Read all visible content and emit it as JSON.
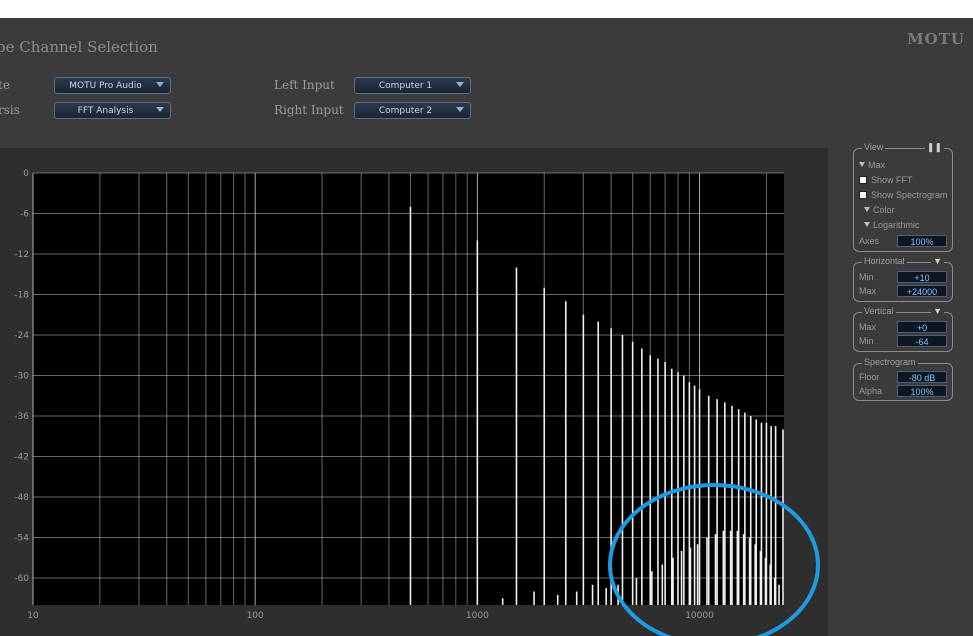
{
  "window": {
    "title": "pe Channel Selection",
    "brand": "MOTU"
  },
  "controls": {
    "device_label": "te",
    "device_value": "MOTU Pro Audio",
    "analysis_label": "rsis",
    "analysis_value": "FFT Analysis",
    "left_input_label": "Left Input",
    "left_input_value": "Computer 1",
    "right_input_label": "Right Input",
    "right_input_value": "Computer 2"
  },
  "view_panel": {
    "title": "View",
    "pause_icon": "pause-icon",
    "items": [
      {
        "kind": "triangle",
        "label": "Max"
      },
      {
        "kind": "checkbox",
        "label": "Show FFT"
      },
      {
        "kind": "checkbox",
        "label": "Show Spectrogram"
      },
      {
        "kind": "triangle",
        "label": "Color"
      },
      {
        "kind": "triangle",
        "label": "Logarithmic"
      }
    ],
    "axes_label": "Axes",
    "axes_value": "100%"
  },
  "horizontal_panel": {
    "title": "Horizontal",
    "min_label": "Min",
    "min_value": "+10",
    "max_label": "Max",
    "max_value": "+24000"
  },
  "vertical_panel": {
    "title": "Vertical",
    "max_label": "Max",
    "max_value": "+0",
    "min_label": "Min",
    "min_value": "-64"
  },
  "spectrogram_panel": {
    "title": "Spectrogram",
    "floor_label": "Floor",
    "floor_value": "-80 dB",
    "alpha_label": "Alpha",
    "alpha_value": "100%"
  },
  "colors": {
    "accent_circle": "#1e9be0",
    "plot_bg": "#000000",
    "bars": "#f0f0f0"
  },
  "chart_data": {
    "type": "bar",
    "xscale": "log",
    "xlim": [
      10,
      24000
    ],
    "ylim": [
      -64,
      0
    ],
    "x_ticks": [
      "10",
      "100",
      "1000",
      "10000"
    ],
    "y_ticks": [
      "0",
      "-6",
      "-12",
      "-18",
      "-24",
      "-30",
      "-36",
      "-42",
      "-48",
      "-54",
      "-60"
    ],
    "grid": true,
    "series": [
      {
        "values": [
          {
            "x": 500,
            "y": -5
          },
          {
            "x": 1000,
            "y": -10
          },
          {
            "x": 1500,
            "y": -14
          },
          {
            "x": 2000,
            "y": -17
          },
          {
            "x": 2500,
            "y": -19
          },
          {
            "x": 3000,
            "y": -21
          },
          {
            "x": 3500,
            "y": -22
          },
          {
            "x": 4000,
            "y": -23
          },
          {
            "x": 4500,
            "y": -24
          },
          {
            "x": 5000,
            "y": -25
          },
          {
            "x": 5500,
            "y": -26
          },
          {
            "x": 6000,
            "y": -27
          },
          {
            "x": 6500,
            "y": -27.5
          },
          {
            "x": 7000,
            "y": -28
          },
          {
            "x": 7500,
            "y": -29
          },
          {
            "x": 8000,
            "y": -29.5
          },
          {
            "x": 8500,
            "y": -30
          },
          {
            "x": 9000,
            "y": -31
          },
          {
            "x": 9500,
            "y": -31.5
          },
          {
            "x": 10000,
            "y": -32
          },
          {
            "x": 11000,
            "y": -33
          },
          {
            "x": 12000,
            "y": -33.5
          },
          {
            "x": 13000,
            "y": -34
          },
          {
            "x": 14000,
            "y": -34.5
          },
          {
            "x": 15000,
            "y": -35
          },
          {
            "x": 16000,
            "y": -35.5
          },
          {
            "x": 17000,
            "y": -36
          },
          {
            "x": 18000,
            "y": -36.5
          },
          {
            "x": 19000,
            "y": -37
          },
          {
            "x": 20000,
            "y": -37
          },
          {
            "x": 21000,
            "y": -37.5
          },
          {
            "x": 22000,
            "y": -37.5
          },
          {
            "x": 24000,
            "y": -38
          }
        ]
      },
      {
        "values": [
          {
            "x": 1300,
            "y": -63
          },
          {
            "x": 1800,
            "y": -62
          },
          {
            "x": 2300,
            "y": -62.5
          },
          {
            "x": 2800,
            "y": -62
          },
          {
            "x": 3300,
            "y": -61
          },
          {
            "x": 3800,
            "y": -61.5
          },
          {
            "x": 4300,
            "y": -61
          },
          {
            "x": 5200,
            "y": -60
          },
          {
            "x": 6100,
            "y": -59
          },
          {
            "x": 6800,
            "y": -58
          },
          {
            "x": 7600,
            "y": -57
          },
          {
            "x": 8300,
            "y": -56
          },
          {
            "x": 9100,
            "y": -55.5
          },
          {
            "x": 9800,
            "y": -55
          },
          {
            "x": 10800,
            "y": -54
          },
          {
            "x": 11800,
            "y": -53.5
          },
          {
            "x": 12800,
            "y": -53
          },
          {
            "x": 13800,
            "y": -53
          },
          {
            "x": 14800,
            "y": -53
          },
          {
            "x": 15800,
            "y": -53.5
          },
          {
            "x": 16800,
            "y": -54
          },
          {
            "x": 17800,
            "y": -55
          },
          {
            "x": 18800,
            "y": -56
          },
          {
            "x": 19800,
            "y": -57
          },
          {
            "x": 20800,
            "y": -58
          },
          {
            "x": 21800,
            "y": -60
          },
          {
            "x": 22800,
            "y": -61
          }
        ]
      }
    ]
  }
}
